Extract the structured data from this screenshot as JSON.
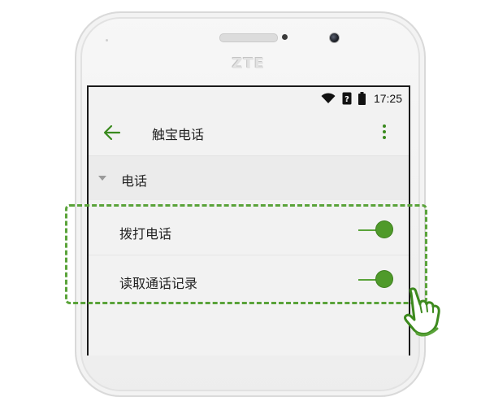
{
  "device": {
    "brand": "ZTE"
  },
  "status_bar": {
    "time": "17:25",
    "icons": [
      "wifi-icon",
      "signal-icon",
      "battery-icon"
    ]
  },
  "app_bar": {
    "title": "触宝电话",
    "back_icon": "arrow-left-icon",
    "menu_icon": "more-vert-icon"
  },
  "category": {
    "label": "电话",
    "state": "expanded"
  },
  "settings": [
    {
      "label": "拨打电话",
      "enabled": true
    },
    {
      "label": "读取通话记录",
      "enabled": true
    }
  ],
  "colors": {
    "accent": "#4f9a2a",
    "highlight": "#5aa33a",
    "screen_bg": "#f2f2f2"
  },
  "annotation": {
    "type": "dashed-highlight",
    "pointer": "hand-tap-icon"
  }
}
